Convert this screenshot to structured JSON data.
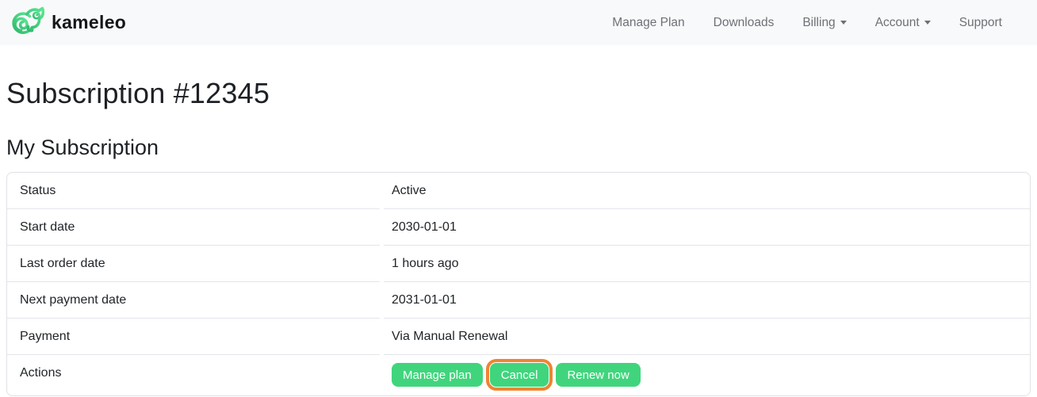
{
  "brand": {
    "name": "kameleo"
  },
  "nav": {
    "items": [
      {
        "label": "Manage Plan",
        "dropdown": false
      },
      {
        "label": "Downloads",
        "dropdown": false
      },
      {
        "label": "Billing",
        "dropdown": true
      },
      {
        "label": "Account",
        "dropdown": true
      },
      {
        "label": "Support",
        "dropdown": false
      }
    ]
  },
  "page": {
    "title": "Subscription #12345",
    "section_title": "My Subscription"
  },
  "subscription": {
    "rows": [
      {
        "label": "Status",
        "value": "Active"
      },
      {
        "label": "Start date",
        "value": "2030-01-01"
      },
      {
        "label": "Last order date",
        "value": "1 hours ago"
      },
      {
        "label": "Next payment date",
        "value": "2031-01-01"
      },
      {
        "label": "Payment",
        "value": "Via Manual Renewal"
      }
    ],
    "actions_label": "Actions",
    "actions": [
      {
        "label": "Manage plan",
        "highlighted": false
      },
      {
        "label": "Cancel",
        "highlighted": true
      },
      {
        "label": "Renew now",
        "highlighted": false
      }
    ]
  },
  "colors": {
    "accent_green": "#40d57d",
    "highlight_orange": "#ef8432",
    "navbar_bg": "#f8f9fa",
    "row_border": "#e4e5ea",
    "text_dark": "#212529",
    "nav_link_gray": "#6d7176",
    "logo_green_dark": "#2fb96d",
    "logo_green_light": "#5ce695"
  }
}
